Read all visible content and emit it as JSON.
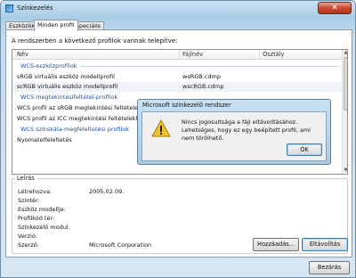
{
  "window": {
    "title": "Színkezelés",
    "close_glyph": "✕"
  },
  "tabs": [
    {
      "label": "Eszközök"
    },
    {
      "label": "Minden profil"
    },
    {
      "label": "Speciális"
    }
  ],
  "main": {
    "intro": "A rendszerben a következő profilok vannak telepítve:",
    "columns": [
      "Név",
      "Fájlnév",
      "Osztály"
    ],
    "rows": [
      {
        "type": "group",
        "name": "WCS-eszközprofilok",
        "file": "",
        "class": ""
      },
      {
        "type": "item",
        "name": "sRGB virtuális eszköz modellprofil",
        "file": "wsRGB.cdmp",
        "class": ""
      },
      {
        "type": "item",
        "name": "scRGB virtuális eszköz modellprofil",
        "file": "wscRGB.cdmp",
        "class": ""
      },
      {
        "type": "group",
        "name": "WCS megtekintésifeltétel-profilok",
        "file": "",
        "class": ""
      },
      {
        "type": "item",
        "name": "WCS profil az sRGB megtekintési feltételekhez",
        "file": "",
        "class": ""
      },
      {
        "type": "item",
        "name": "WCS profil az ICC megtekintési feltételekhez",
        "file": "",
        "class": ""
      },
      {
        "type": "group",
        "name": "WCS színskála-megfeleltetési profilok",
        "file": "",
        "class": ""
      },
      {
        "type": "item",
        "name": "Nyomatelfeleltetés",
        "file": "",
        "class": ""
      }
    ]
  },
  "description": {
    "title": "Leírás",
    "fields": [
      {
        "label": "Létrehozva:",
        "value": "2005.02.09."
      },
      {
        "label": "Színtér:",
        "value": ""
      },
      {
        "label": "Eszköz modellje:",
        "value": ""
      },
      {
        "label": "Profilkód tér:",
        "value": ""
      },
      {
        "label": "Színkezelő modul:",
        "value": ""
      },
      {
        "label": "Verzió:",
        "value": ""
      },
      {
        "label": "Szerző:",
        "value": "Microsoft Corporation"
      }
    ]
  },
  "buttons": {
    "add": "Hozzáadás...",
    "remove": "Eltávolítás",
    "close": "Bezárás"
  },
  "dialog": {
    "title": "Microsoft színkezelő rendszer",
    "message": "Nincs jogosultsága a fájl eltávolításához. Lehetséges, hogy ez egy beépített profil, ami nem törölhető.",
    "ok": "OK"
  },
  "colors": {
    "group_text": "#1e50a2",
    "selected_row": "#f0f4f8",
    "warning": "#f2c12e"
  },
  "icons": {
    "scroll_up": "▲",
    "scroll_down": "▼"
  }
}
